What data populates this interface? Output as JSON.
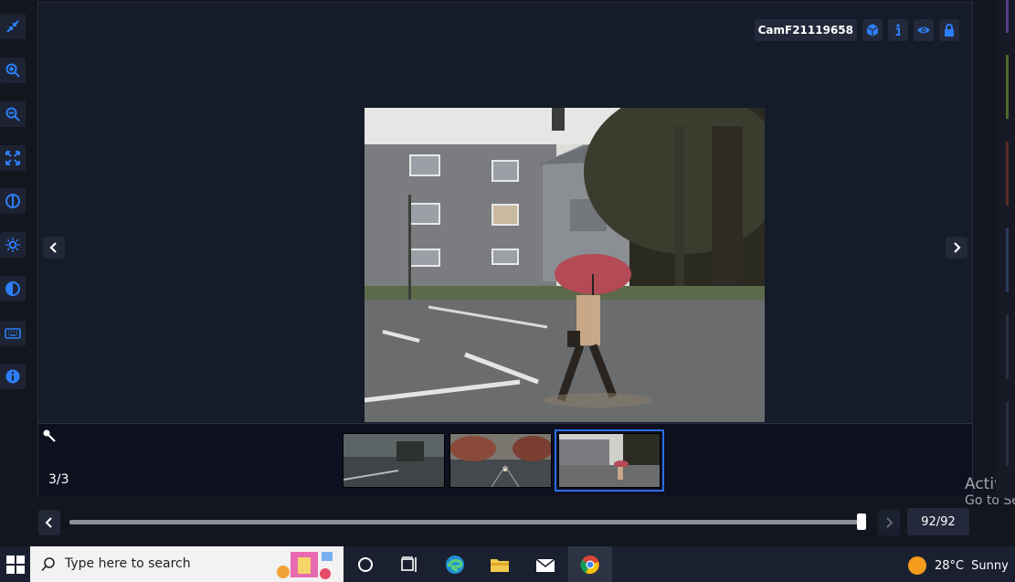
{
  "viewer": {
    "camera_label": "CamF21119658",
    "counter": "3/3",
    "frame_count": "92/92",
    "slider_fraction": 1.0
  },
  "toolbar": {
    "tools": [
      "collapse-icon",
      "zoom-in-icon",
      "zoom-out-icon",
      "fit-screen-icon",
      "flip-icon",
      "brightness-icon",
      "contrast-icon",
      "keyboard-icon",
      "info-icon"
    ]
  },
  "header_icons": [
    "cube-icon",
    "info-icon",
    "eye-icon",
    "lock-icon"
  ],
  "watermark": {
    "line1": "Activa",
    "line2": "Go to Se"
  },
  "taskbar": {
    "search_placeholder": "Type here to search",
    "temperature": "28°C",
    "condition": "Sunny"
  },
  "colors": {
    "accent": "#2a6ee8",
    "icon_blue": "#2d7ff9",
    "background": "#161b2a"
  }
}
